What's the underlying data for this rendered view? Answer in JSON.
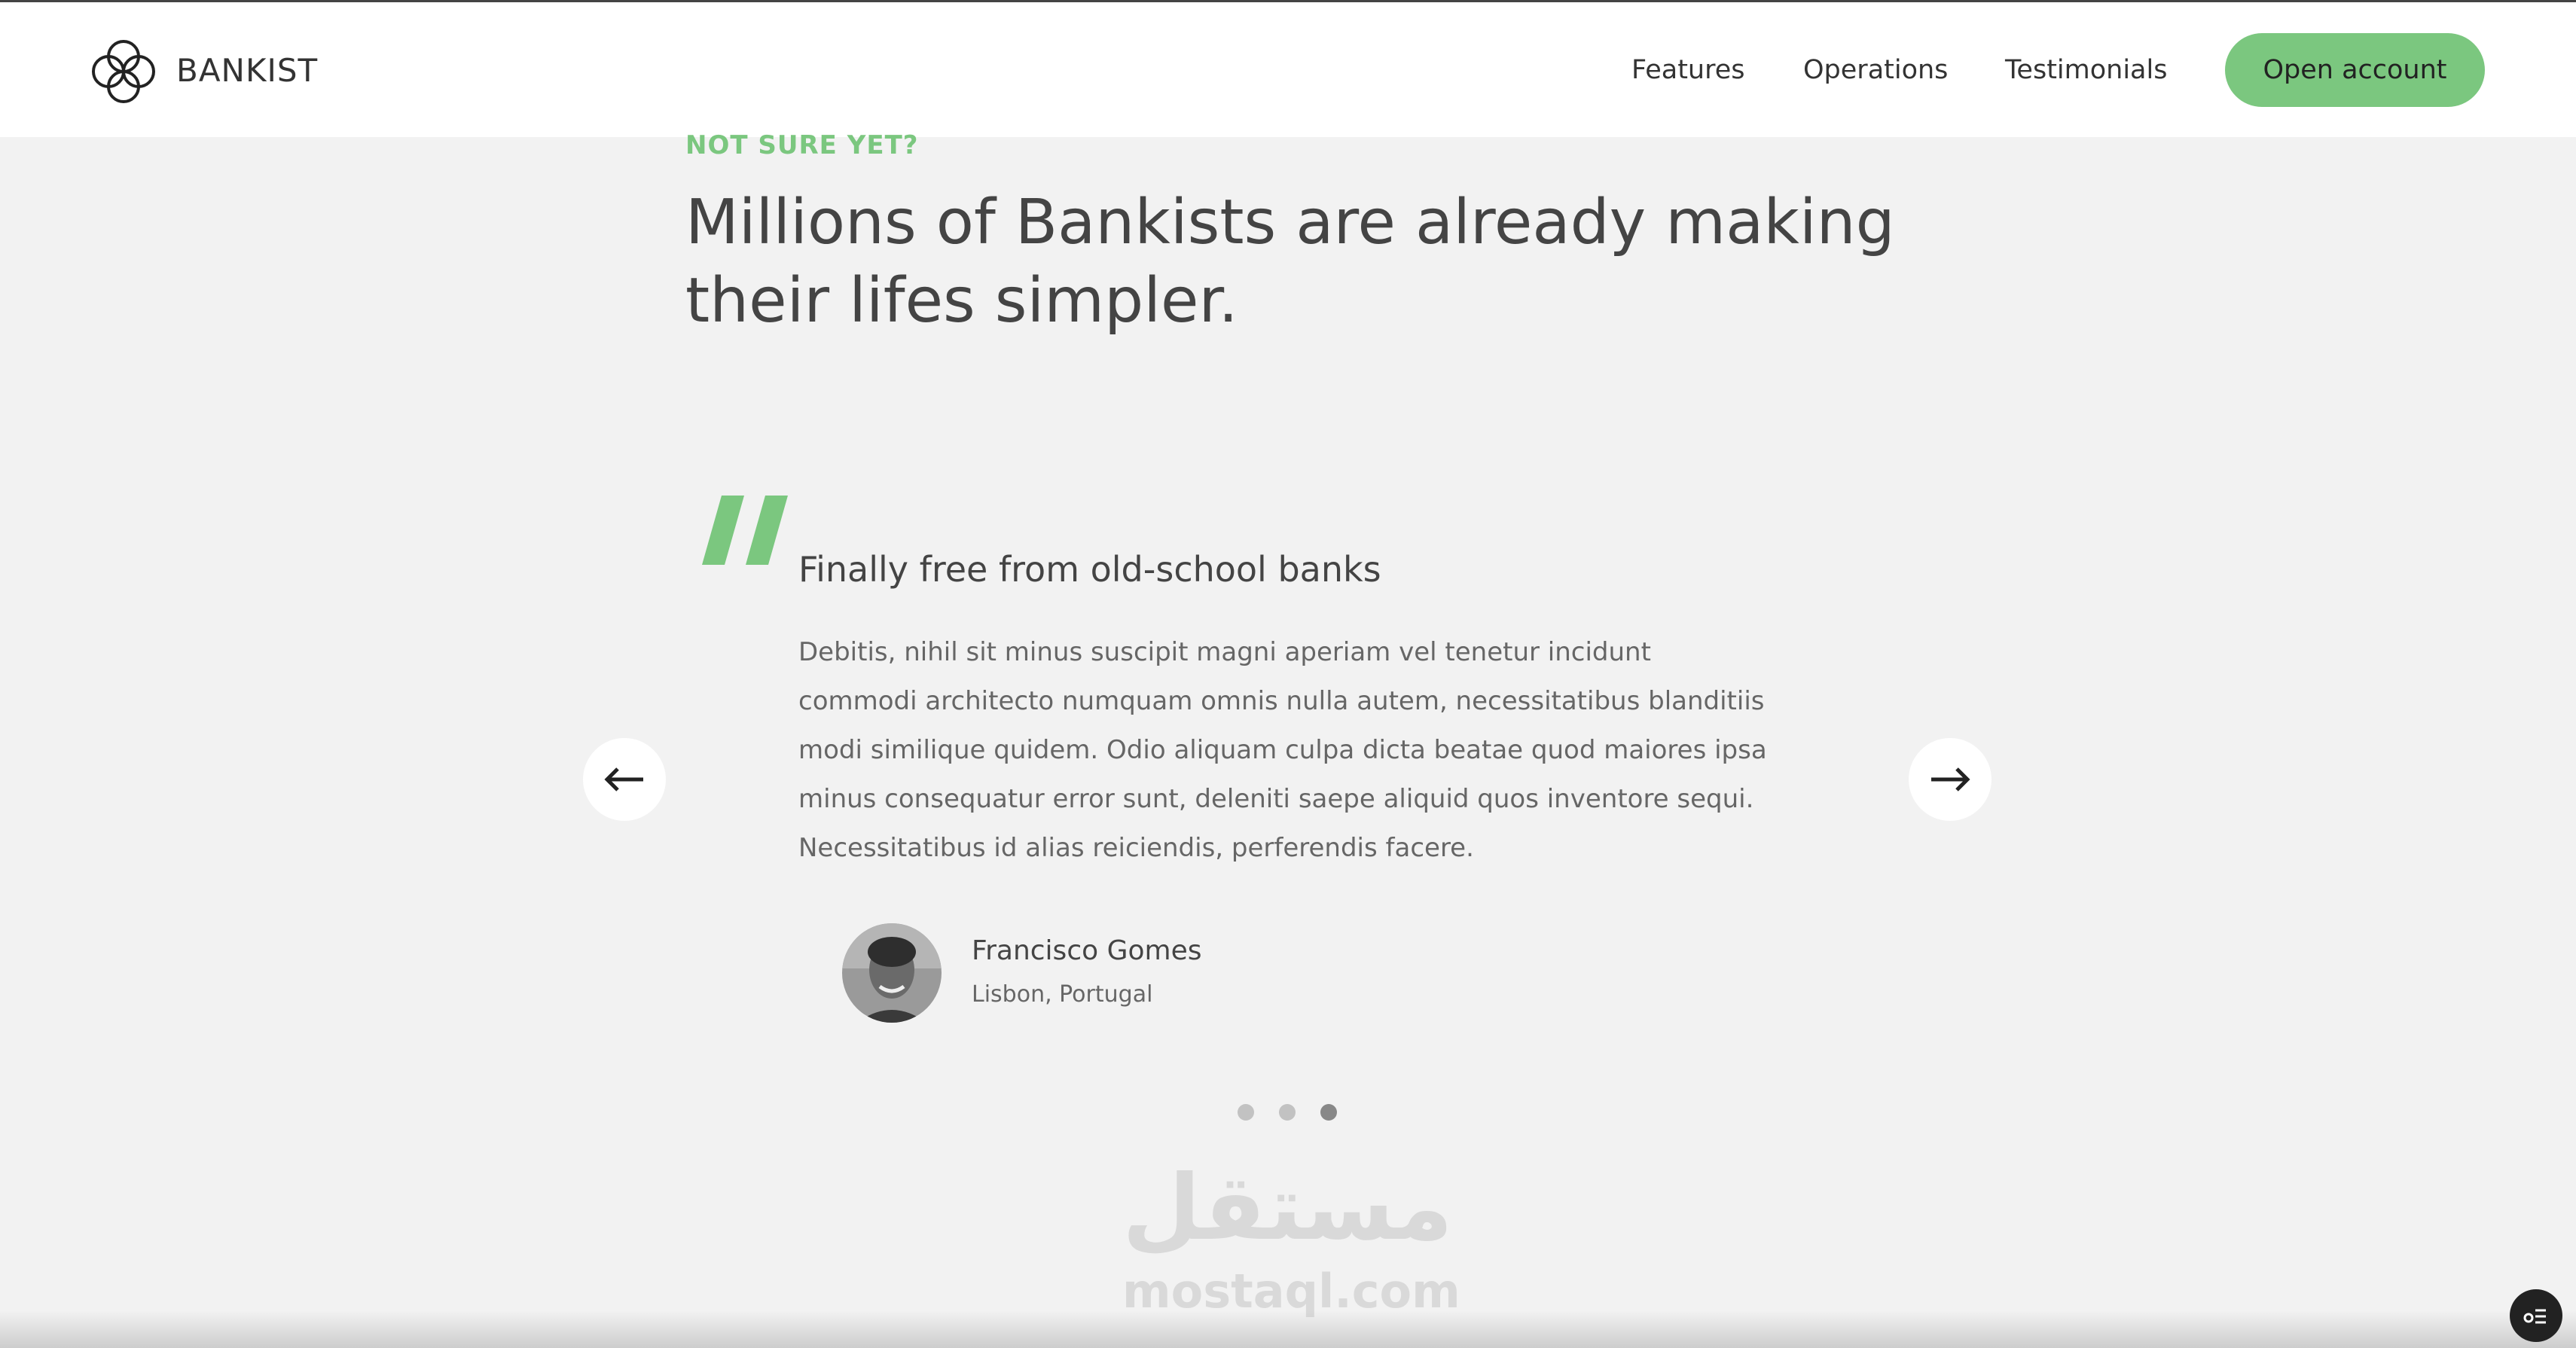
{
  "nav": {
    "brand": "BANKIST",
    "links": [
      "Features",
      "Operations",
      "Testimonials"
    ],
    "cta_label": "Open account"
  },
  "section": {
    "eyebrow": "NOT SURE YET?",
    "headline": "Millions of Bankists are already making their lifes simpler."
  },
  "testimonial": {
    "title": "Finally free from old-school banks",
    "body": "Debitis, nihil sit minus suscipit magni aperiam vel tenetur incidunt commodi architecto numquam omnis nulla autem, necessitatibus blanditiis modi similique quidem. Odio aliquam culpa dicta beatae quod maiores ipsa minus consequatur error sunt, deleniti saepe aliquid quos inventore sequi. Necessitatibus id alias reiciendis, perferendis facere.",
    "author_name": "Francisco Gomes",
    "author_location": "Lisbon, Portugal"
  },
  "slider": {
    "dots": 3,
    "active_index": 2
  },
  "watermark": {
    "arabic": "مستقل",
    "latin": "mostaql.com"
  },
  "colors": {
    "accent": "#7bc77f",
    "background": "#f2f2f2",
    "text": "#444444"
  },
  "icons": {
    "logo": "bankist-logo-icon",
    "prev": "arrow-left-icon",
    "next": "arrow-right-icon",
    "quote": "quote-mark-icon",
    "widget": "toc-icon"
  }
}
